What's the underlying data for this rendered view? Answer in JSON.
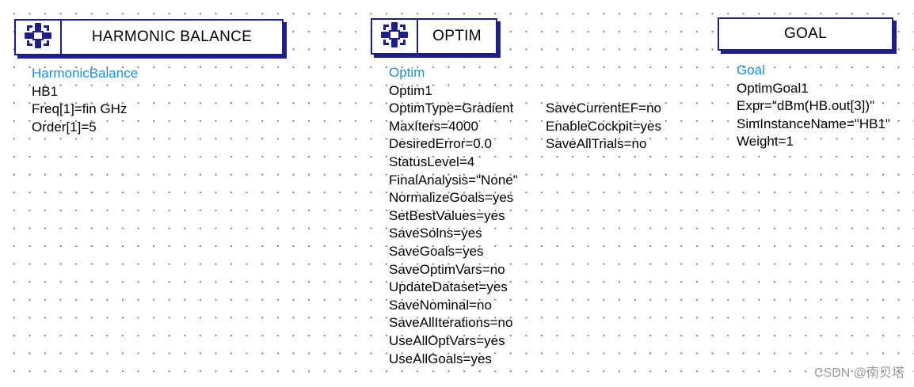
{
  "harmonic_balance": {
    "title": "HARMONIC BALANCE",
    "icon": "ads-simulation-component-icon",
    "params": [
      "HarmonicBalance",
      "HB1",
      "Freq[1]=fin GHz",
      "Order[1]=5"
    ]
  },
  "optim": {
    "title": "OPTIM",
    "icon": "ads-simulation-component-icon",
    "params_col1": [
      "Optim",
      "Optim1",
      "OptimType=Gradient",
      "MaxIters=4000",
      "DesiredError=0.0",
      "StatusLevel=4",
      "FinalAnalysis=\"None\"",
      "NormalizeGoals=yes",
      "SetBestValues=yes",
      "SaveSolns=yes",
      "SaveGoals=yes",
      "SaveOptimVars=no",
      "UpdateDataset=yes",
      "SaveNominal=no",
      "SaveAllIterations=no",
      "UseAllOptVars=yes",
      "UseAllGoals=yes"
    ],
    "params_col2": [
      "SaveCurrentEF=no",
      "EnableCockpit=yes",
      "SaveAllTrials=no"
    ]
  },
  "goal": {
    "title": "GOAL",
    "params": [
      "Goal",
      "OptimGoal1",
      "Expr=\"dBm(HB.out[3])\"",
      "SimInstanceName=\"HB1\"",
      "Weight=1"
    ]
  },
  "colors": {
    "border": "#1d1d8c",
    "highlight": "#1e8ee0",
    "text": "#000000"
  },
  "watermark": "CSDN @南贝塔"
}
